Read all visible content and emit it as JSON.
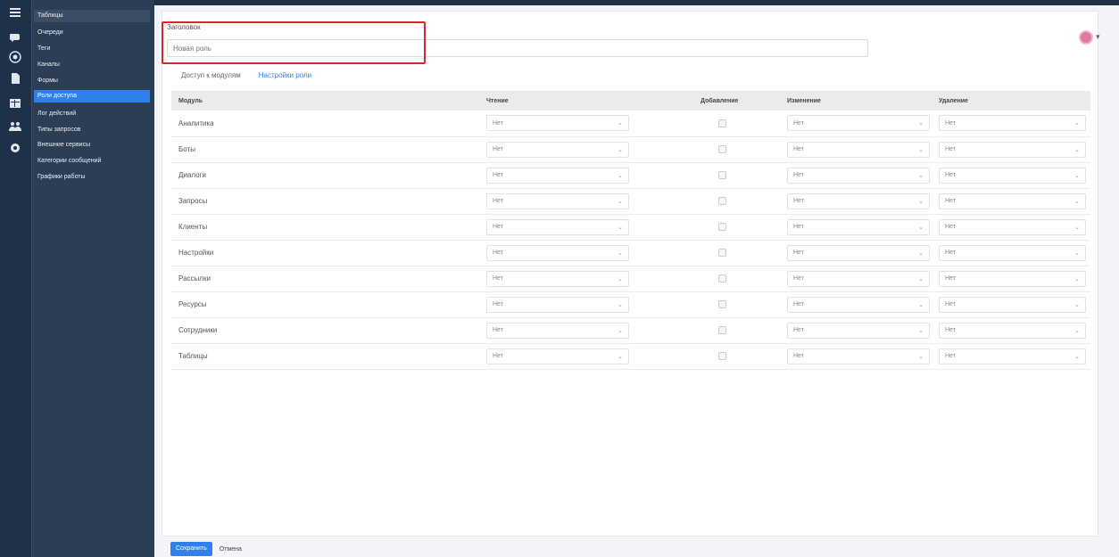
{
  "sidebar": {
    "items": [
      {
        "label": "Таблицы",
        "active": false
      },
      {
        "label": "Очереди",
        "active": false
      },
      {
        "label": "Теги",
        "active": false
      },
      {
        "label": "Каналы",
        "active": false
      },
      {
        "label": "Формы",
        "active": false
      },
      {
        "label": "Роли доступа",
        "active": true
      },
      {
        "label": "Лог действий",
        "active": false
      },
      {
        "label": "Типы запросов",
        "active": false
      },
      {
        "label": "Внешние сервисы",
        "active": false
      },
      {
        "label": "Категории сообщений",
        "active": false
      },
      {
        "label": "Графики работы",
        "active": false
      }
    ]
  },
  "iconbar": {
    "icons": [
      "menu-icon",
      "chat-icon",
      "support-icon",
      "document-icon",
      "table-icon",
      "users-icon",
      "gear-icon"
    ]
  },
  "form": {
    "title_label": "Заголовок",
    "title_value": "Новая роль",
    "tabs": [
      {
        "label": "Доступ к модулям",
        "style": "plain"
      },
      {
        "label": "Настройки роли",
        "style": "link"
      }
    ]
  },
  "table": {
    "headers": [
      "Модуль",
      "Чтение",
      "Добавление",
      "Изменение",
      "Удаление"
    ],
    "rows": [
      {
        "module": "Аналитика",
        "read": "Нет",
        "edit": "Нет",
        "delete": "Нет"
      },
      {
        "module": "Боты",
        "read": "Нет",
        "edit": "Нет",
        "delete": "Нет"
      },
      {
        "module": "Диалоги",
        "read": "Нет",
        "edit": "Нет",
        "delete": "Нет"
      },
      {
        "module": "Запросы",
        "read": "Нет",
        "edit": "Нет",
        "delete": "Нет"
      },
      {
        "module": "Клиенты",
        "read": "Нет",
        "edit": "Нет",
        "delete": "Нет"
      },
      {
        "module": "Настройки",
        "read": "Нет",
        "edit": "Нет",
        "delete": "Нет"
      },
      {
        "module": "Рассылки",
        "read": "Нет",
        "edit": "Нет",
        "delete": "Нет"
      },
      {
        "module": "Ресурсы",
        "read": "Нет",
        "edit": "Нет",
        "delete": "Нет"
      },
      {
        "module": "Сотрудники",
        "read": "Нет",
        "edit": "Нет",
        "delete": "Нет"
      },
      {
        "module": "Таблицы",
        "read": "Нет",
        "edit": "Нет",
        "delete": "Нет"
      }
    ]
  },
  "footer": {
    "save_label": "Сохранить",
    "cancel_label": "Отмена"
  },
  "colors": {
    "accent": "#2f80ed",
    "sidebar_bg": "#2b3e55",
    "iconbar_bg": "#1e3148",
    "highlight": "#d9262f"
  }
}
